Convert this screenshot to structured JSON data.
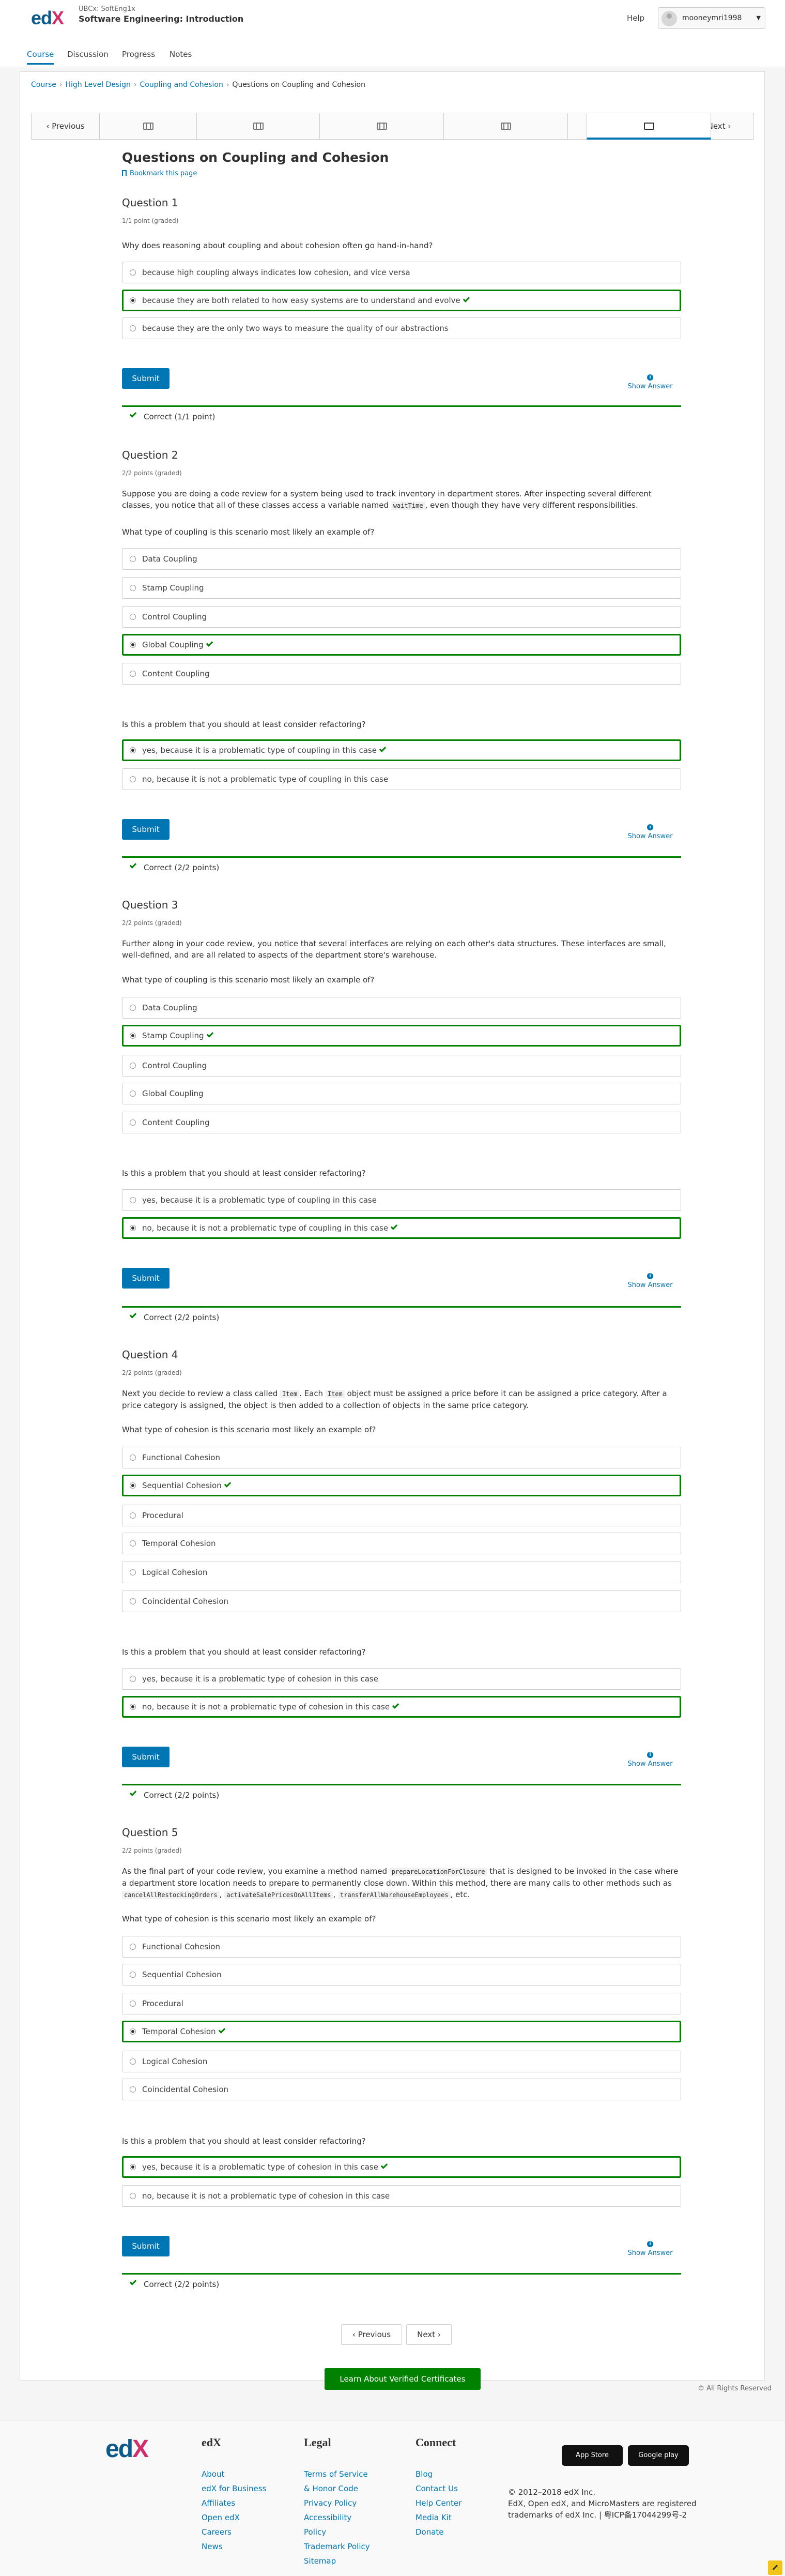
{
  "header": {
    "org": "UBCx: SoftEng1x",
    "course_title": "Software Engineering: Introduction",
    "help": "Help",
    "username": "mooneymri1998"
  },
  "tabs": [
    "Course",
    "Discussion",
    "Progress",
    "Notes"
  ],
  "breadcrumb": [
    "Course",
    "High Level Design",
    "Coupling and Cohesion",
    "Questions on Coupling and Cohesion"
  ],
  "sequence": {
    "previous": "Previous",
    "next": "Next"
  },
  "unit": {
    "title": "Questions on Coupling and Cohesion",
    "bookmark": "Bookmark this page"
  },
  "labels": {
    "submit": "Submit",
    "show_answer": "Show Answer"
  },
  "questions": [
    {
      "title": "Question 1",
      "points": "1/1 point (graded)",
      "prompt": "Why does reasoning about coupling and about cohesion often go hand-in-hand?",
      "options": [
        "because high coupling always indicates low cohesion, and vice versa",
        "because they are both related to how easy systems are to understand and evolve",
        "because they are the only two ways to measure the quality of our abstractions"
      ],
      "correct": "Correct (1/1 point)"
    },
    {
      "title": "Question 2",
      "points": "2/2 points (graded)",
      "intro_a": "Suppose you are doing a code review for a system being used to track inventory in department stores. After inspecting several different classes, you notice that all of these classes access a variable named",
      "intro_code": "waitTime",
      "intro_b": ", even though they have very different responsibilities.",
      "prompt": "What type of coupling is this scenario most likely an example of?",
      "options": [
        "Data Coupling",
        "Stamp Coupling",
        "Control Coupling",
        "Global Coupling",
        "Content Coupling"
      ],
      "prompt2": "Is this a problem that you should at least consider refactoring?",
      "options2": [
        "yes, because it is a problematic type of coupling in this case",
        "no, because it is not a problematic type of coupling in this case"
      ],
      "correct": "Correct (2/2 points)"
    },
    {
      "title": "Question 3",
      "points": "2/2 points (graded)",
      "intro": "Further along in your code review, you notice that several interfaces are relying on each other's data structures. These interfaces are small, well-defined, and are all related to aspects of the department store's warehouse.",
      "prompt": "What type of coupling is this scenario most likely an example of?",
      "options": [
        "Data Coupling",
        "Stamp Coupling",
        "Control Coupling",
        "Global Coupling",
        "Content Coupling"
      ],
      "prompt2": "Is this a problem that you should at least consider refactoring?",
      "options2": [
        "yes, because it is a problematic type of coupling in this case",
        "no, because it is not a problematic type of coupling in this case"
      ],
      "correct": "Correct (2/2 points)"
    },
    {
      "title": "Question 4",
      "points": "2/2 points (graded)",
      "intro_a": "Next you decide to review a class called",
      "intro_code1": "Item",
      "intro_b": ". Each",
      "intro_code2": "Item",
      "intro_c": "object must be assigned a price before it can be assigned a price category. After a price category is assigned, the object is then added to a collection of objects in the same price category.",
      "prompt": "What type of cohesion is this scenario most likely an example of?",
      "options": [
        "Functional Cohesion",
        "Sequential Cohesion",
        "Procedural",
        "Temporal Cohesion",
        "Logical Cohesion",
        "Coincidental Cohesion"
      ],
      "prompt2": "Is this a problem that you should at least consider refactoring?",
      "options2": [
        "yes, because it is a problematic type of cohesion in this case",
        "no, because it is not a problematic type of cohesion in this case"
      ],
      "correct": "Correct (2/2 points)"
    },
    {
      "title": "Question 5",
      "points": "2/2 points (graded)",
      "intro_a": "As the final part of your code review, you examine a method named",
      "intro_code1": "prepareLocationForClosure",
      "intro_b": "that is designed to be invoked in the case where a department store location needs to prepare to permanently close down. Within this method, there are many calls to other methods such as",
      "intro_code2": "cancelAllRestockingOrders",
      "intro_c": ",",
      "intro_code3": "activateSalePricesOnAllItems",
      "intro_d": ",",
      "intro_code4": "transferAllWarehouseEmployees",
      "intro_e": ", etc.",
      "prompt": "What type of cohesion is this scenario most likely an example of?",
      "options": [
        "Functional Cohesion",
        "Sequential Cohesion",
        "Procedural",
        "Temporal Cohesion",
        "Logical Cohesion",
        "Coincidental Cohesion"
      ],
      "prompt2": "Is this a problem that you should at least consider refactoring?",
      "options2": [
        "yes, because it is a problematic type of cohesion in this case",
        "no, because it is not a problematic type of cohesion in this case"
      ],
      "correct": "Correct (2/2 points)"
    }
  ],
  "bottom_nav": {
    "previous": "Previous",
    "next": "Next"
  },
  "cert_button": "Learn About Verified Certificates",
  "rights": "© All Rights Reserved",
  "footer": {
    "edx": {
      "heading": "edX",
      "links": [
        "About",
        "edX for Business",
        "Affiliates",
        "Open edX",
        "Careers",
        "News"
      ]
    },
    "legal": {
      "heading": "Legal",
      "links": [
        "Terms of Service & Honor Code",
        "Privacy Policy",
        "Accessibility Policy",
        "Trademark Policy",
        "Sitemap"
      ]
    },
    "connect": {
      "heading": "Connect",
      "links": [
        "Blog",
        "Contact Us",
        "Help Center",
        "Media Kit",
        "Donate"
      ]
    },
    "app_store": "App Store",
    "google_play": "Google play",
    "copyright": "© 2012–2018 edX Inc.",
    "trademark": "EdX, Open edX, and MicroMasters are registered trademarks of edX Inc. | 粤ICP备17044299号-2"
  },
  "colors": {
    "accent": "#0075b4",
    "correct": "#008100"
  }
}
